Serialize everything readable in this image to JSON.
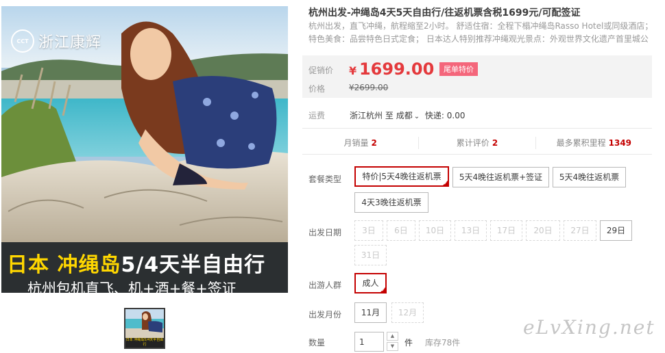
{
  "gallery": {
    "brand_mark": "CCT",
    "brand_name": "浙江康辉",
    "banner_line1_accent": "日本 冲绳岛",
    "banner_line1_rest": "5/4天半自由行",
    "banner_line2": "杭州包机直飞、机+酒+餐+签证",
    "thumb_caption": "日本 冲绳岛5/4天半自由行"
  },
  "product": {
    "title": "杭州出发-冲绳岛4天5天自由行/往返机票含税1699元/可配签证",
    "subtitle": "杭州出发，直飞冲绳，航程缩至2小时。 舒适住宿：全程下榻冲绳岛Rasso Hotel或同级酒店； 特色美食：品尝特色日式定食； 日本达人特别推荐冲绳观光景点：外观世界文化遗产首里城公园；"
  },
  "price": {
    "promo_label": "促销价",
    "currency": "¥",
    "promo_value": "1699.00",
    "promo_tag": "尾单特价",
    "original_label": "价格",
    "original_value": "¥2699.00",
    "accent_color": "#e4393c"
  },
  "shipping": {
    "label": "运费",
    "from": "浙江杭州",
    "to_word": "至",
    "destination": "成都",
    "dropdown_icon": "chevron-down-icon",
    "fee_text": "快递: 0.00"
  },
  "stats": {
    "monthly_sales_label": "月销量",
    "monthly_sales_value": "2",
    "reviews_label": "累计评价",
    "reviews_value": "2",
    "points_label": "最多累积里程",
    "points_value": "1349"
  },
  "package": {
    "label": "套餐类型",
    "options": [
      "特价|5天4晚往返机票",
      "5天4晚往返机票+签证",
      "5天4晚往返机票",
      "4天3晚往返机票"
    ],
    "selected_index": 0
  },
  "departure_date": {
    "label": "出发日期",
    "options": [
      "3日",
      "6日",
      "10日",
      "13日",
      "17日",
      "20日",
      "27日",
      "29日",
      "31日"
    ],
    "available_index": 7
  },
  "travelers": {
    "label": "出游人群",
    "options": [
      "成人"
    ],
    "selected_index": 0
  },
  "departure_month": {
    "label": "出发月份",
    "options": [
      "11月",
      "12月"
    ],
    "available_index": 0
  },
  "quantity": {
    "label": "数量",
    "value": "1",
    "unit": "件",
    "stock": "库存78件",
    "up_icon": "caret-up-icon",
    "down_icon": "caret-down-icon"
  },
  "watermark": "eLvXing.net"
}
